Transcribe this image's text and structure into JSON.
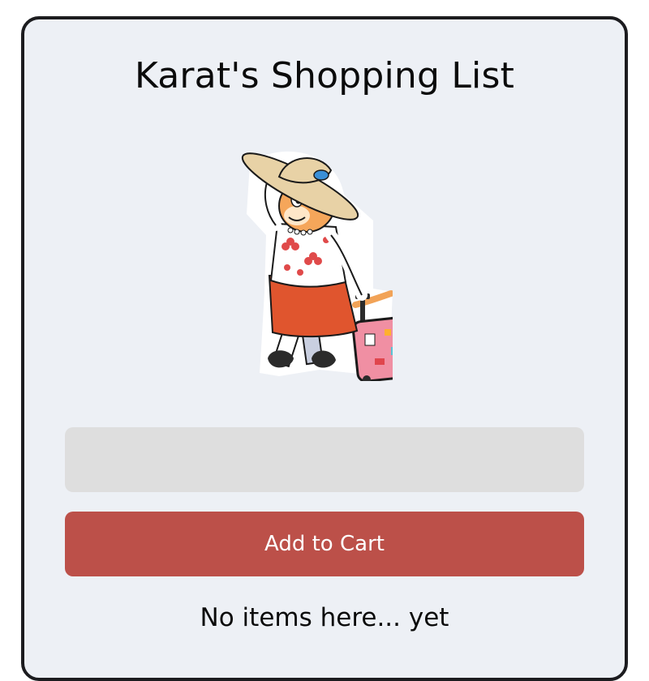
{
  "app": {
    "title": "Karat's Shopping List"
  },
  "mascot": {
    "icon": "cat-traveler-with-suitcase"
  },
  "form": {
    "input_value": "",
    "input_placeholder": "",
    "button_label": "Add to Cart"
  },
  "list": {
    "empty_message": "No items here... yet"
  },
  "colors": {
    "background": "#edf0f5",
    "border": "#1c1c1f",
    "input": "#dedede",
    "button": "#bc5049",
    "button_text": "#ffffff"
  }
}
